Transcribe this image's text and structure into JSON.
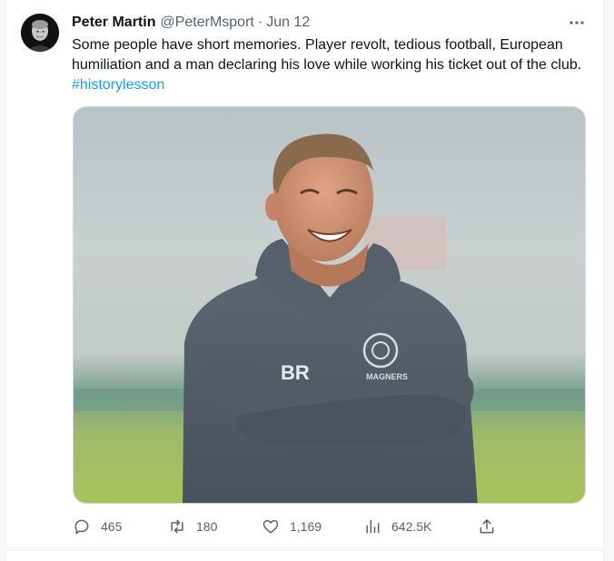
{
  "tweet": {
    "author_name": "Peter Martin",
    "handle": "@PeterMsport",
    "separator": "·",
    "date": "Jun 12",
    "text": "Some people have short memories. Player revolt, tedious football, European humiliation and a man declaring his love while working his ticket out of the club. ",
    "hashtag": "#historylesson",
    "media": {
      "jacket_text_left": "BR",
      "jacket_text_right": "MAGNERS"
    }
  },
  "actions": {
    "replies": "465",
    "retweets": "180",
    "likes": "1,169",
    "views": "642.5K"
  },
  "icons": {
    "more": "more-horizontal-icon",
    "reply": "reply-bubble-icon",
    "retweet": "retweet-arrows-icon",
    "like": "heart-icon",
    "views": "bar-chart-icon",
    "share": "share-upload-icon"
  },
  "colors": {
    "link": "#1d9bf0",
    "text": "#0f1419",
    "muted": "#536471"
  }
}
